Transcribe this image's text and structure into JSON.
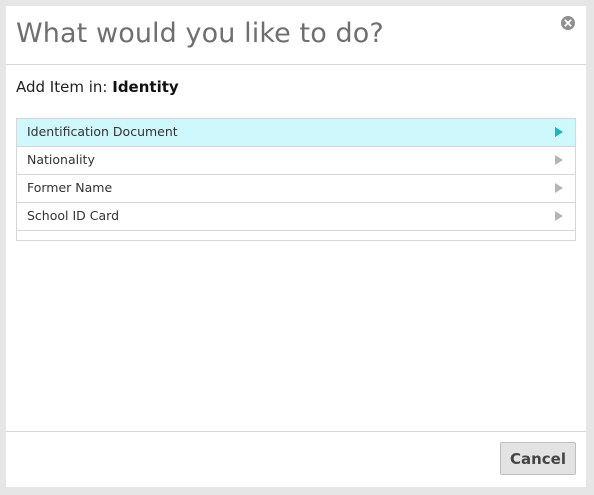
{
  "dialog": {
    "title": "What would you like to do?",
    "close_icon": "close-circle-icon"
  },
  "subheading": {
    "prefix": "Add Item in:",
    "context": "Identity"
  },
  "items": [
    {
      "label": "Identification Document",
      "selected": true,
      "icon": "chevron-right-icon"
    },
    {
      "label": "Nationality",
      "selected": false,
      "icon": "chevron-right-icon"
    },
    {
      "label": "Former Name",
      "selected": false,
      "icon": "chevron-right-icon"
    },
    {
      "label": "School ID Card",
      "selected": false,
      "icon": "chevron-right-icon"
    }
  ],
  "footer": {
    "cancel_label": "Cancel"
  },
  "colors": {
    "selected_row": "#cff8fc",
    "selected_arrow": "#1ab4c2",
    "title_text": "#6f6f6f"
  }
}
